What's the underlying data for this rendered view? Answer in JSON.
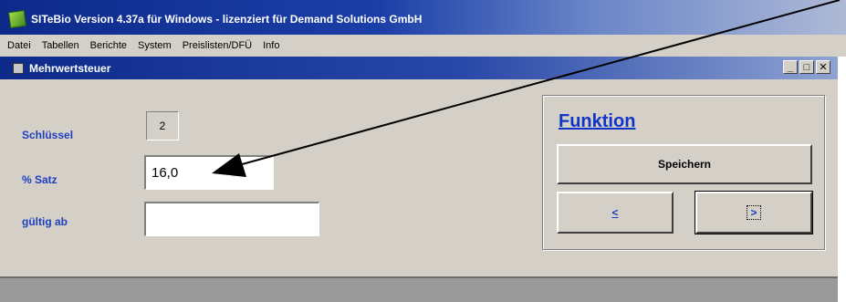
{
  "app": {
    "title": "SITeBio Version 4.37a für Windows - lizenziert für Demand Solutions GmbH"
  },
  "menu": {
    "items": [
      "Datei",
      "Tabellen",
      "Berichte",
      "System",
      "Preislisten/DFÜ",
      "Info"
    ]
  },
  "window": {
    "title": "Mehrwertsteuer",
    "controls": {
      "minimize": "_",
      "maximize": "□",
      "close": "✕"
    }
  },
  "form": {
    "key_label": "Schlüssel",
    "key_value": "2",
    "rate_label": "% Satz",
    "rate_value": "16,0",
    "valid_label": "gültig ab",
    "valid_value": ""
  },
  "funktion": {
    "title": "Funktion",
    "save_label": "Speichern",
    "prev_label": "<",
    "next_label": ">"
  },
  "colors": {
    "label_blue": "#1f3fc0",
    "title_blue": "#0d2a8a",
    "face": "#d4d0c8"
  }
}
